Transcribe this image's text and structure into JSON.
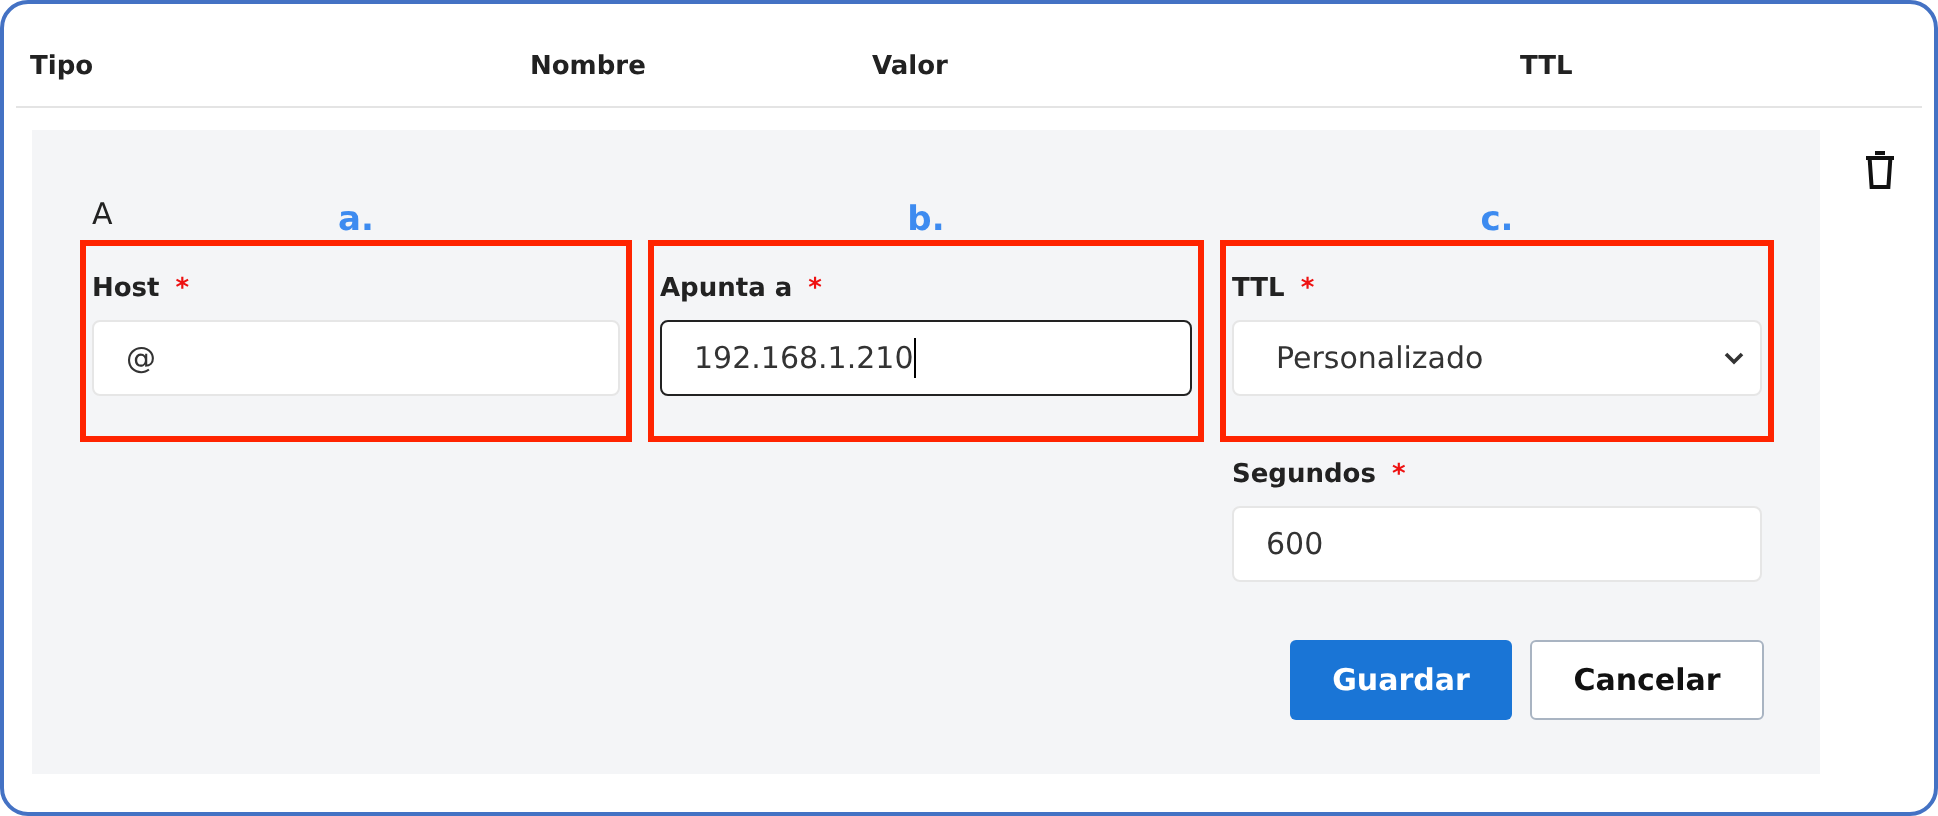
{
  "table": {
    "columns": [
      "Tipo",
      "Nombre",
      "Valor",
      "TTL"
    ]
  },
  "record": {
    "type": "A",
    "fields": [
      {
        "kind": "text",
        "annotation": "a.",
        "label": "Host",
        "required_mark": "*",
        "value": "@",
        "highlighted": true,
        "focused": false
      },
      {
        "kind": "text",
        "annotation": "b.",
        "label": "Apunta a",
        "required_mark": "*",
        "value": "192.168.1.210",
        "highlighted": true,
        "focused": true
      },
      {
        "kind": "select",
        "annotation": "c.",
        "label": "TTL",
        "required_mark": "*",
        "value": "Personalizado",
        "highlighted": true,
        "focused": false
      },
      {
        "kind": "text",
        "label": "Segundos",
        "required_mark": "*",
        "value": "600",
        "highlighted": false,
        "focused": false
      }
    ],
    "buttons": [
      {
        "label": "Guardar",
        "kind": "primary"
      },
      {
        "label": "Cancelar",
        "kind": "secondary"
      }
    ]
  }
}
